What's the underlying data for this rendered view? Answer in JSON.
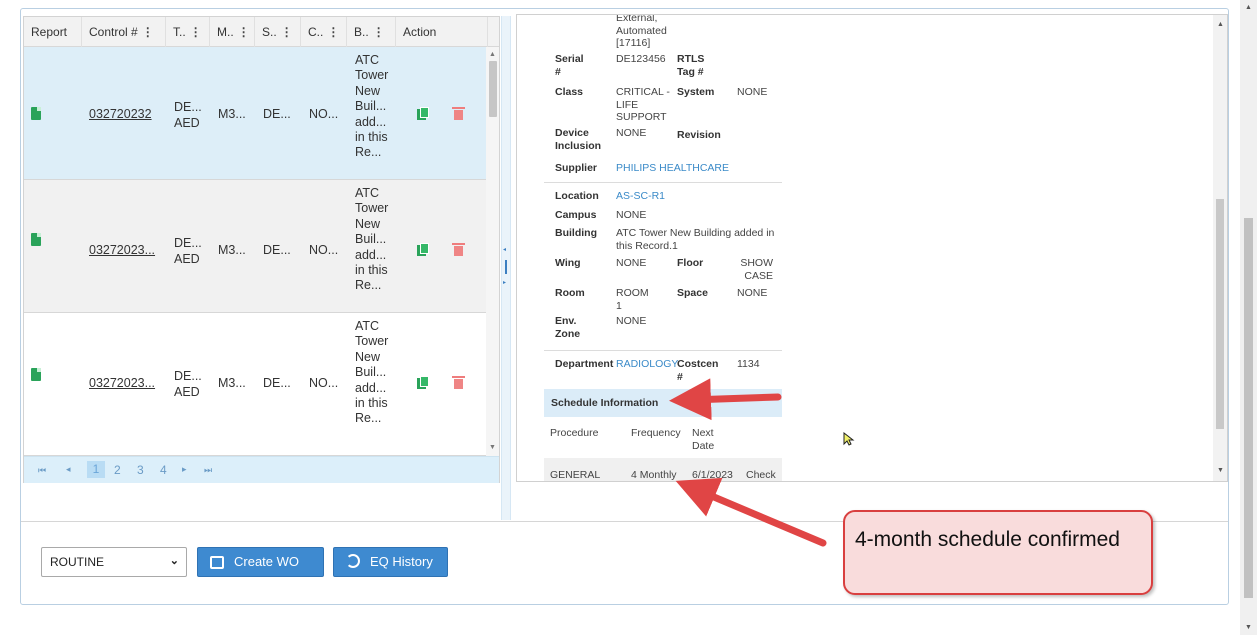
{
  "grid": {
    "columns": [
      {
        "label": "Report",
        "menu": false
      },
      {
        "label": "Control #",
        "menu": true
      },
      {
        "label": "T..",
        "menu": true
      },
      {
        "label": "M..",
        "menu": true
      },
      {
        "label": "S..",
        "menu": true
      },
      {
        "label": "C..",
        "menu": true
      },
      {
        "label": "B..",
        "menu": true
      },
      {
        "label": "Action",
        "menu": false
      }
    ],
    "rows": [
      {
        "control": "032720232",
        "type": "DE... AED",
        "model": "M3...",
        "status": "DE...",
        "class": "NO...",
        "building": "ATC Tower New Buil... add... in this Re...",
        "selected": true
      },
      {
        "control": "03272023...",
        "type": "DE... AED",
        "model": "M3...",
        "status": "DE...",
        "class": "NO...",
        "building": "ATC Tower New Buil... add... in this Re...",
        "selected": false
      },
      {
        "control": "03272023...",
        "type": "DE... AED",
        "model": "M3...",
        "status": "DE...",
        "class": "NO...",
        "building": "ATC Tower New Buil... add... in this Re...",
        "selected": false
      }
    ],
    "pager": {
      "first": "⏮",
      "prev": "◂",
      "pages": [
        "1",
        "2",
        "3",
        "4"
      ],
      "current_page": "1",
      "next": "▸",
      "last": "⏭"
    }
  },
  "detail": {
    "top_text": "External, Automated [17116]",
    "serial_label": "Serial #",
    "serial_value": "DE123456",
    "rtls_label": "RTLS Tag #",
    "class_label": "Class",
    "class_value": "CRITICAL - LIFE SUPPORT",
    "system_label": "System",
    "system_value": "NONE",
    "inclusion_label": "Device Inclusion",
    "inclusion_value": "NONE",
    "revision_label": "Revision",
    "supplier_label": "Supplier",
    "supplier_value": "PHILIPS HEALTHCARE",
    "location_label": "Location",
    "location_value": "AS-SC-R1",
    "campus_label": "Campus",
    "campus_value": "NONE",
    "building_label": "Building",
    "building_value": "ATC Tower New Building added in this Record.1",
    "wing_label": "Wing",
    "wing_value": "NONE",
    "floor_label": "Floor",
    "floor_value": "SHOW CASE",
    "room_label": "Room",
    "room_value": "ROOM 1",
    "space_label": "Space",
    "space_value": "NONE",
    "env_label": "Env. Zone",
    "env_value": "NONE",
    "department_label": "Department",
    "department_value": "RADIOLOGY",
    "costcen_label": "Costcen #",
    "costcen_value": "1134",
    "schedule_header": "Schedule Information",
    "sched_col_procedure": "Procedure",
    "sched_col_frequency": "Frequency",
    "sched_col_next": "Next Date",
    "sched_row_procedure": "GENERAL",
    "sched_row_frequency": "4 Monthly",
    "sched_row_next": "6/1/2023",
    "sched_row_action": "Check"
  },
  "footer": {
    "wo_type": "ROUTINE",
    "create_wo": "Create WO",
    "eq_history": "EQ History"
  },
  "annotation": {
    "callout_text": "4-month schedule confirmed"
  },
  "colors": {
    "accent": "#3e8ad0",
    "link": "#3a8ac8",
    "selected_row": "#ddeef8",
    "callout_border": "#d93f3f",
    "callout_fill": "#f9dcdc",
    "report_icon": "#2aa35a",
    "delete_icon": "#ef8585"
  },
  "icons": {
    "report": "document-icon",
    "copy": "copy-icon",
    "delete": "trash-icon",
    "create_wo": "clipboard-edit-icon",
    "eq_history": "history-icon"
  }
}
